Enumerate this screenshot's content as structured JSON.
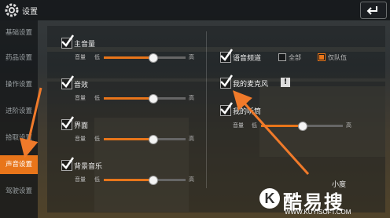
{
  "window": {
    "title": "设置"
  },
  "sidebar": {
    "items": [
      {
        "label": "基础设置"
      },
      {
        "label": "药品设置"
      },
      {
        "label": "操作设置"
      },
      {
        "label": "进阶设置"
      },
      {
        "label": "拾取设置"
      },
      {
        "label": "声音设置"
      },
      {
        "label": "驾驶设置"
      }
    ],
    "active_index": 5
  },
  "left": {
    "groups": [
      {
        "label": "主音量",
        "checked": true,
        "slider_label": "音量",
        "low": "低",
        "high": "高",
        "level": 0.6
      },
      {
        "label": "音效",
        "checked": true,
        "slider_label": "音量",
        "low": "低",
        "high": "高",
        "level": 0.6
      },
      {
        "label": "界面",
        "checked": true,
        "slider_label": "音量",
        "low": "低",
        "high": "高",
        "level": 0.6
      },
      {
        "label": "背景音乐",
        "checked": true,
        "slider_label": "音量",
        "low": "低",
        "high": "高",
        "level": 0.6
      }
    ]
  },
  "right": {
    "voice_channel": {
      "label": "语音频道",
      "checked": true,
      "options": [
        "全部",
        "仅队伍"
      ],
      "selected": "仅队伍"
    },
    "mic": {
      "label": "我的麦克风",
      "checked": true,
      "warn": "!"
    },
    "listen": {
      "label": "我的听筒",
      "checked": true,
      "slider_label": "音量",
      "low": "低",
      "high": "高",
      "level": 0.5
    }
  },
  "watermark": {
    "brand": "酷易搜",
    "url": "WWW.KUYISOFT.COM",
    "extra": "小度",
    "letter": "K"
  },
  "colors": {
    "accent": "#e8751a",
    "arrow": "#f07a2a"
  }
}
